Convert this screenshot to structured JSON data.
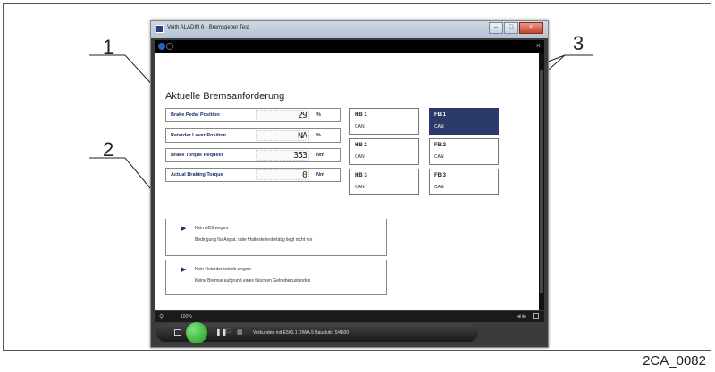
{
  "figure_code": "2CA_0082",
  "callouts": [
    "1",
    "2",
    "3"
  ],
  "window": {
    "title": "Voith ALADIN 6 · Bremsgeber Test",
    "controls": {
      "minimize": "–",
      "maximize": "□",
      "close": "×"
    }
  },
  "app": {
    "close_glyph": "×"
  },
  "section": {
    "heading": "Aktuelle Bremsanforderung"
  },
  "signals": [
    {
      "label": "Brake Pedal Position",
      "value": "29",
      "unit": "%"
    },
    {
      "label": "Retarder Lever Position",
      "value": "NA",
      "unit": "%"
    },
    {
      "label": "Brake Torque Request",
      "value": "353",
      "unit": "Nm"
    },
    {
      "label": "Actual Braking Torque",
      "value": "0",
      "unit": "Nm"
    }
  ],
  "buses": [
    {
      "name": "HB 1",
      "type": "CAN",
      "active": false
    },
    {
      "name": "FB 1",
      "type": "CAN",
      "active": true
    },
    {
      "name": "HB 2",
      "type": "CAN",
      "active": false
    },
    {
      "name": "FB 2",
      "type": "CAN",
      "active": false
    },
    {
      "name": "HB 3",
      "type": "CAN",
      "active": false
    },
    {
      "name": "FB 3",
      "type": "CAN",
      "active": false
    }
  ],
  "messages": [
    {
      "title": "Kein ABS wegen:",
      "detail": "Bedingung für Anpat. oder Haltestellenbetätig liegt nicht vor"
    },
    {
      "title": "Kein Retarderbetrieb wegen:",
      "detail": "Keine Bremse aufgrund eines falschen Getriebezustandes"
    }
  ],
  "statusbar": {
    "zoom": "100%"
  },
  "dock": {
    "pause_glyph": "❚❚",
    "connection_status": "Verbunden mit E500.1 DIWA.5 Baustufe: 5/4600"
  },
  "colors": {
    "active_bus": "#2b3a68",
    "label_text": "#1a2f66",
    "go_button": "#1c9c1c"
  }
}
